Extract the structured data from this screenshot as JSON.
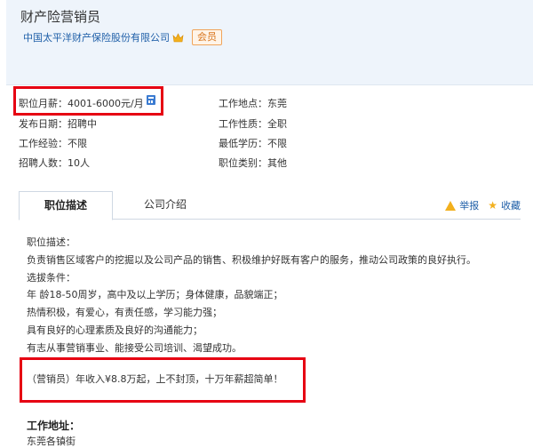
{
  "header": {
    "job_title": "财产险营销员",
    "company": "中国太平洋财产保险股份有限公司",
    "member_badge": "会员"
  },
  "info": {
    "salary": "职位月薪：4001-6000元/月",
    "location": "工作地点：东莞",
    "publish_date": "发布日期：招聘中",
    "job_nature": "工作性质：全职",
    "experience": "工作经验：不限",
    "education": "最低学历：不限",
    "headcount": "招聘人数：10人",
    "category": "职位类别：其他"
  },
  "tabs": {
    "description": "职位描述",
    "company_intro": "公司介绍"
  },
  "actions": {
    "report": "举报",
    "favorite": "收藏"
  },
  "description": {
    "lines": [
      "职位描述：",
      "负责销售区域客户的挖掘以及公司产品的销售、积极维护好既有客户的服务，推动公司政策的良好执行。",
      "选拔条件：",
      "年  龄18-50周岁，高中及以上学历；身体健康，品貌端正；",
      "热情积极，有爱心，有责任感，学习能力强；",
      "具有良好的心理素质及良好的沟通能力；",
      "有志从事营销事业、能接受公司培训、渴望成功。"
    ],
    "income": "（营销员）年收入¥8.8万起，上不封顶，十万年薪超简单！"
  },
  "address": {
    "label": "工作地址：",
    "value": "东莞各镇街"
  },
  "icons": {
    "crown": "crown-icon",
    "calculator": "calculator-icon",
    "warning": "warning-icon",
    "star": "star-icon"
  },
  "colors": {
    "highlight": "#e60012",
    "link": "#1f5fa8",
    "badge": "#d8741b"
  }
}
